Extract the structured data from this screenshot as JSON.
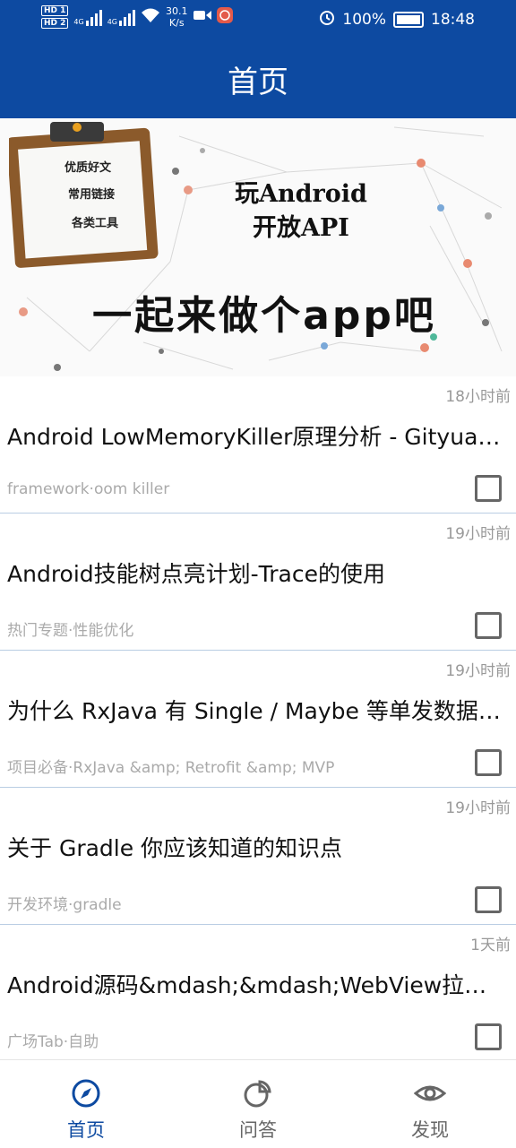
{
  "status_bar": {
    "sim1": "HD 1",
    "sim2": "HD 2",
    "signal1": "4G",
    "signal2": "4G",
    "net_speed": "30.1",
    "net_unit": "K/s",
    "battery": "100%",
    "time": "18:48"
  },
  "app_bar": {
    "title": "首页"
  },
  "banner": {
    "clipboard_items": [
      "优质好文",
      "常用链接",
      "各类工具"
    ],
    "title_line1": "玩Android",
    "title_line2": "开放API",
    "slogan": "一起来做个app吧"
  },
  "articles": [
    {
      "time": "18小时前",
      "title": "Android LowMemoryKiller原理分析 - Gityuan博客 | 袁辉辉的技术博客",
      "tags": "framework·oom killer"
    },
    {
      "time": "19小时前",
      "title": "Android技能树点亮计划-Trace的使用",
      "tags": "热门专题·性能优化"
    },
    {
      "time": "19小时前",
      "title": "为什么 RxJava 有 Single / Maybe 等单发数据类型？",
      "tags": "项目必备·RxJava &amp; Retrofit &amp; MVP"
    },
    {
      "time": "19小时前",
      "title": "关于 Gradle 你应该知道的知识点",
      "tags": "开发环境·gradle"
    },
    {
      "time": "1天前",
      "title": "Android源码&mdash;&mdash;WebView拉起三方应用",
      "tags": "广场Tab·自助"
    }
  ],
  "bottom_nav": [
    {
      "label": "首页",
      "icon": "home-compass-icon",
      "active": true
    },
    {
      "label": "问答",
      "icon": "pie-chart-icon",
      "active": false
    },
    {
      "label": "发现",
      "icon": "eye-icon",
      "active": false
    }
  ],
  "colors": {
    "primary": "#0d4aa1",
    "active_nav": "#0d4aa1",
    "inactive_nav": "#666666",
    "divider": "#b9cde3"
  }
}
